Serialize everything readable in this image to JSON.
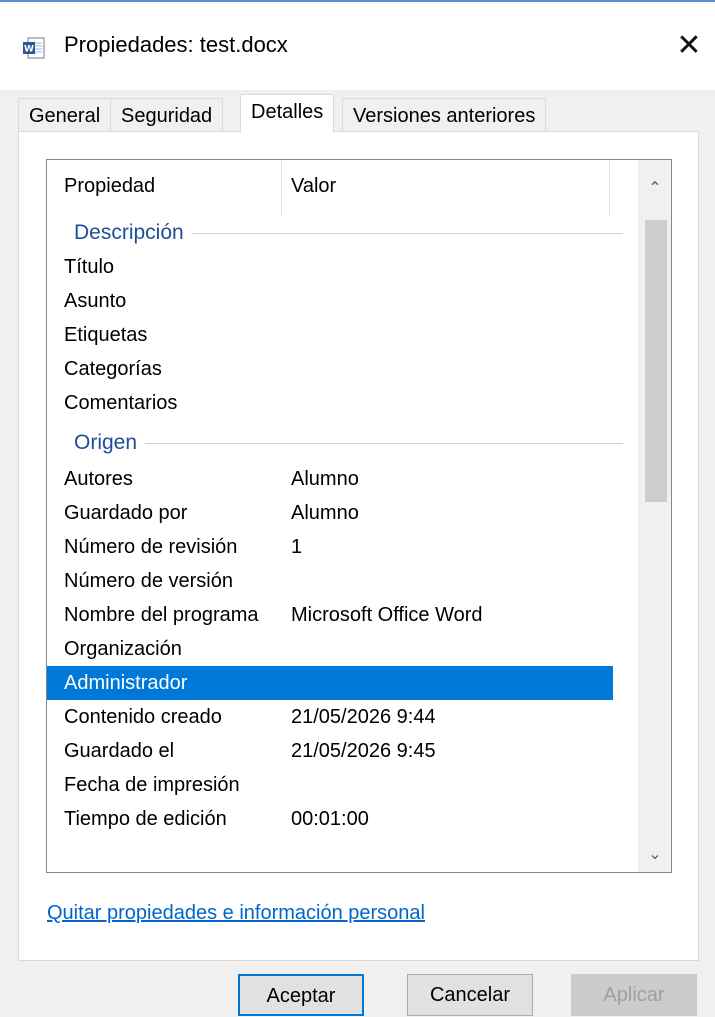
{
  "window": {
    "title": "Propiedades: test.docx",
    "close_symbol": "✕",
    "app_icon": "word-document-icon"
  },
  "tabs": [
    {
      "label": "General"
    },
    {
      "label": "Seguridad"
    },
    {
      "label": "Detalles",
      "active": true
    },
    {
      "label": "Versiones anteriores"
    }
  ],
  "list": {
    "headers": {
      "property": "Propiedad",
      "value": "Valor"
    },
    "groups": {
      "description": "Descripción",
      "origin": "Origen"
    },
    "description_rows": [
      {
        "name": "Título",
        "value": ""
      },
      {
        "name": "Asunto",
        "value": ""
      },
      {
        "name": "Etiquetas",
        "value": ""
      },
      {
        "name": "Categorías",
        "value": ""
      },
      {
        "name": "Comentarios",
        "value": ""
      }
    ],
    "origin_rows": [
      {
        "name": "Autores",
        "value": "Alumno"
      },
      {
        "name": "Guardado por",
        "value": "Alumno"
      },
      {
        "name": "Número de revisión",
        "value": "1"
      },
      {
        "name": "Número de versión",
        "value": ""
      },
      {
        "name": "Nombre del programa",
        "value": "Microsoft Office Word"
      },
      {
        "name": "Organización",
        "value": ""
      },
      {
        "name": "Administrador",
        "value": "",
        "selected": true
      },
      {
        "name": "Contenido creado",
        "value": "21/05/2026 9:44"
      },
      {
        "name": "Guardado el",
        "value": "21/05/2026 9:45"
      },
      {
        "name": "Fecha de impresión",
        "value": ""
      },
      {
        "name": "Tiempo de edición",
        "value": "00:01:00"
      }
    ],
    "scroll_up_symbol": "⌃",
    "scroll_down_symbol": "⌄"
  },
  "link_label": "Quitar propiedades e información personal",
  "buttons": {
    "ok": "Aceptar",
    "cancel": "Cancelar",
    "apply": "Aplicar"
  },
  "colors": {
    "accent": "#0078d7",
    "group_label": "#1e4e9a",
    "link": "#0066cc"
  }
}
